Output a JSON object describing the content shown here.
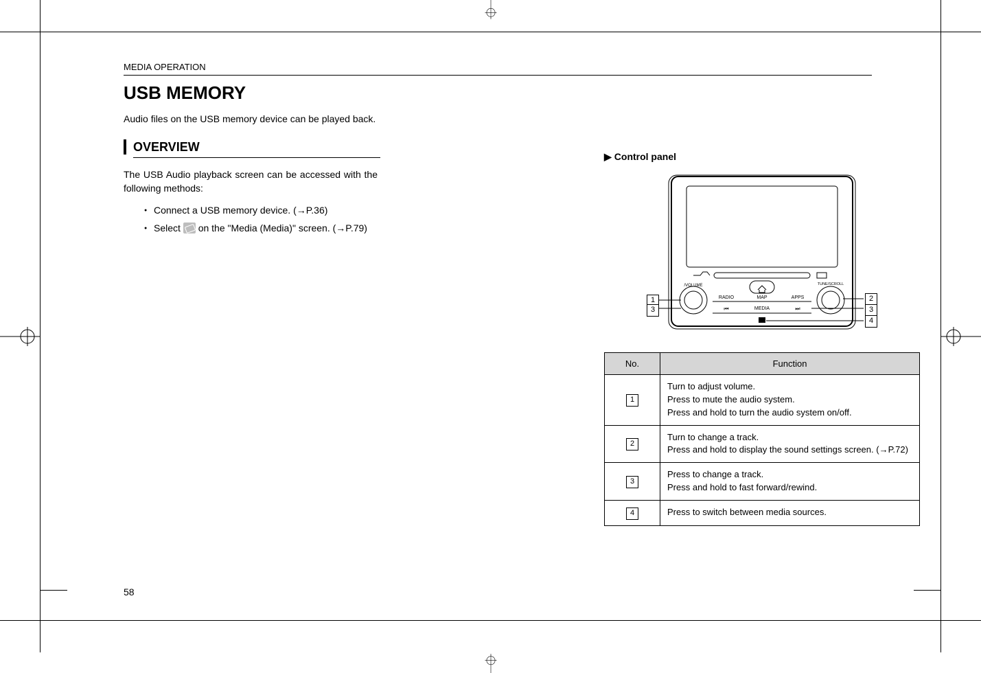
{
  "header": {
    "section": "MEDIA OPERATION"
  },
  "left": {
    "title": "USB MEMORY",
    "lead": "Audio files on the USB memory device can be played back.",
    "subhead": "OVERVIEW",
    "para": "The USB Audio playback screen can be accessed with the following methods:",
    "bullet1": "Connect a USB memory device. (→P.36)",
    "bullet2_pre": "Select ",
    "bullet2_post": " on the \"Media (Media)\" screen. (→P.79)"
  },
  "right": {
    "heading": "Control panel",
    "panel_labels": {
      "volume": "/VOLUME",
      "tune": "TUNE/SCROLL",
      "radio": "RADIO",
      "map": "MAP",
      "apps": "APPS",
      "media": "MEDIA",
      "home_icon": "home-icon",
      "prev_icon": "prev-track-icon",
      "next_icon": "next-track-icon",
      "eject_icon": "eject-icon",
      "sd_icon": "sd-card-icon"
    },
    "table": {
      "headers": {
        "no": "No.",
        "fn": "Function"
      },
      "rows": [
        {
          "num": "1",
          "fn": "Turn to adjust volume.\nPress to mute the audio system.\nPress and hold to turn the audio system on/off."
        },
        {
          "num": "2",
          "fn": "Turn to change a track.\nPress and hold to display the sound settings screen. (→P.72)"
        },
        {
          "num": "3",
          "fn": "Press to change a track.\nPress and hold to fast forward/rewind."
        },
        {
          "num": "4",
          "fn": "Press to switch between media sources."
        }
      ]
    }
  },
  "pagenum": "58"
}
